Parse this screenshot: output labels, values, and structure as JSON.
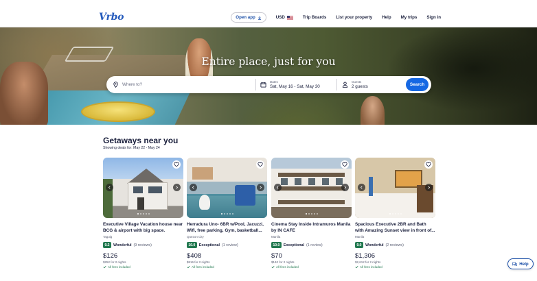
{
  "header": {
    "logo": "Vrbo",
    "open_app": "Open app",
    "currency": "USD",
    "nav": [
      "Trip Boards",
      "List your property",
      "Help",
      "My trips",
      "Sign in"
    ]
  },
  "hero": {
    "title": "Entire place, just for you"
  },
  "search": {
    "where_placeholder": "Where to?",
    "dates_label": "Dates",
    "dates_value": "Sat, May 16 - Sat, May 30",
    "guests_label": "Guests",
    "guests_value": "2 guests",
    "button": "Search"
  },
  "getaways": {
    "title": "Getaways near you",
    "subtitle": "Showing deals for: May 22 - May 24",
    "cards": [
      {
        "title": "Executive Village Vacation house near BCG & airport with big space.",
        "location": "Taguig",
        "score": "9.2",
        "rating_word": "Wonderful",
        "reviews": "(9 reviews)",
        "price": "$126",
        "total": "$252 for 2 nights",
        "fees": "All fees included"
      },
      {
        "title": "Herradura Uno- 6BR w/Pool, Jacuzzi, Wifi, free parking, Gym, basketball...",
        "location": "Quezon City",
        "score": "10.0",
        "rating_word": "Exceptional",
        "reviews": "(1 review)",
        "price": "$408",
        "total": "$816 for 2 nights",
        "fees": "All fees included"
      },
      {
        "title": "Cinema Stay Inside Intramuros Manila by IN CAFE",
        "location": "Manila",
        "score": "10.0",
        "rating_word": "Exceptional",
        "reviews": "(1 review)",
        "price": "$70",
        "total": "$140 for 2 nights",
        "fees": "All fees included"
      },
      {
        "title": "Spacious Executive 2BR and Bath with Amazing Sunset view in front of...",
        "location": "Manila",
        "score": "9.0",
        "rating_word": "Wonderful",
        "reviews": "(2 reviews)",
        "price": "$1,306",
        "total": "$2,612 for 2 nights",
        "fees": "All fees included"
      }
    ]
  },
  "help_button": "Help",
  "colors": {
    "brand": "#245abc",
    "primary_button": "#1668e3",
    "rating_badge": "#227950"
  }
}
